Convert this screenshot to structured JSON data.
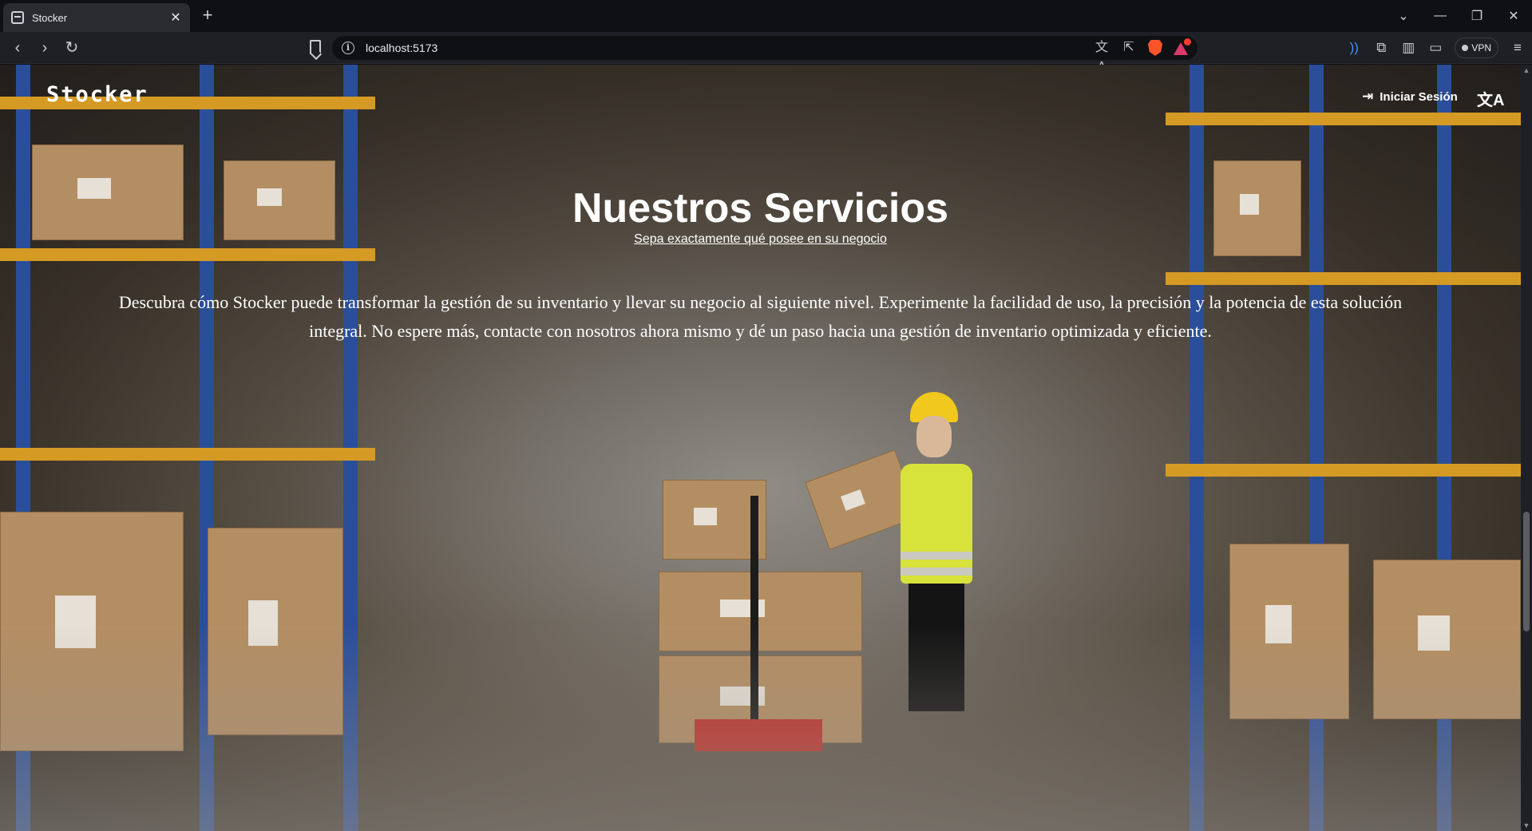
{
  "browser": {
    "tab_title": "Stocker",
    "tab_close": "✕",
    "new_tab": "+",
    "url": "localhost:5173",
    "vpn_label": "VPN",
    "window_controls": {
      "dropdown": "⌄",
      "minimize": "—",
      "restore": "❐",
      "close": "✕"
    },
    "nav": {
      "back": "‹",
      "forward": "›",
      "reload": "↻"
    },
    "url_icons": {
      "translate": "文A",
      "share": "⇱"
    },
    "tool_icons": {
      "wallet_connect": "))",
      "extensions": "⧉",
      "sidebar": "▥",
      "wallet": "▭",
      "menu": "≡"
    }
  },
  "site": {
    "logo": "Stocker",
    "login_label": "Iniciar Sesión",
    "login_icon": "⇥",
    "language_icon": "文A"
  },
  "hero": {
    "title": "Nuestros Servicios",
    "subtitle": "Sepa exactamente qué posee en su negocio",
    "body": "Descubra cómo Stocker puede transformar la gestión de su inventario y llevar su negocio al siguiente nivel. Experimente la facilidad de uso, la precisión y la potencia de esta solución integral. No espere más, contacte con nosotros ahora mismo y dé un paso hacia una gestión de inventario optimizada y eficiente."
  },
  "scroll": {
    "up": "▲",
    "down": "▼"
  },
  "colors": {
    "rack_blue": "#2b4e9a",
    "rack_orange": "#d49a24",
    "vest_yellow": "#d7e23a",
    "helmet_yellow": "#f0c81e"
  }
}
